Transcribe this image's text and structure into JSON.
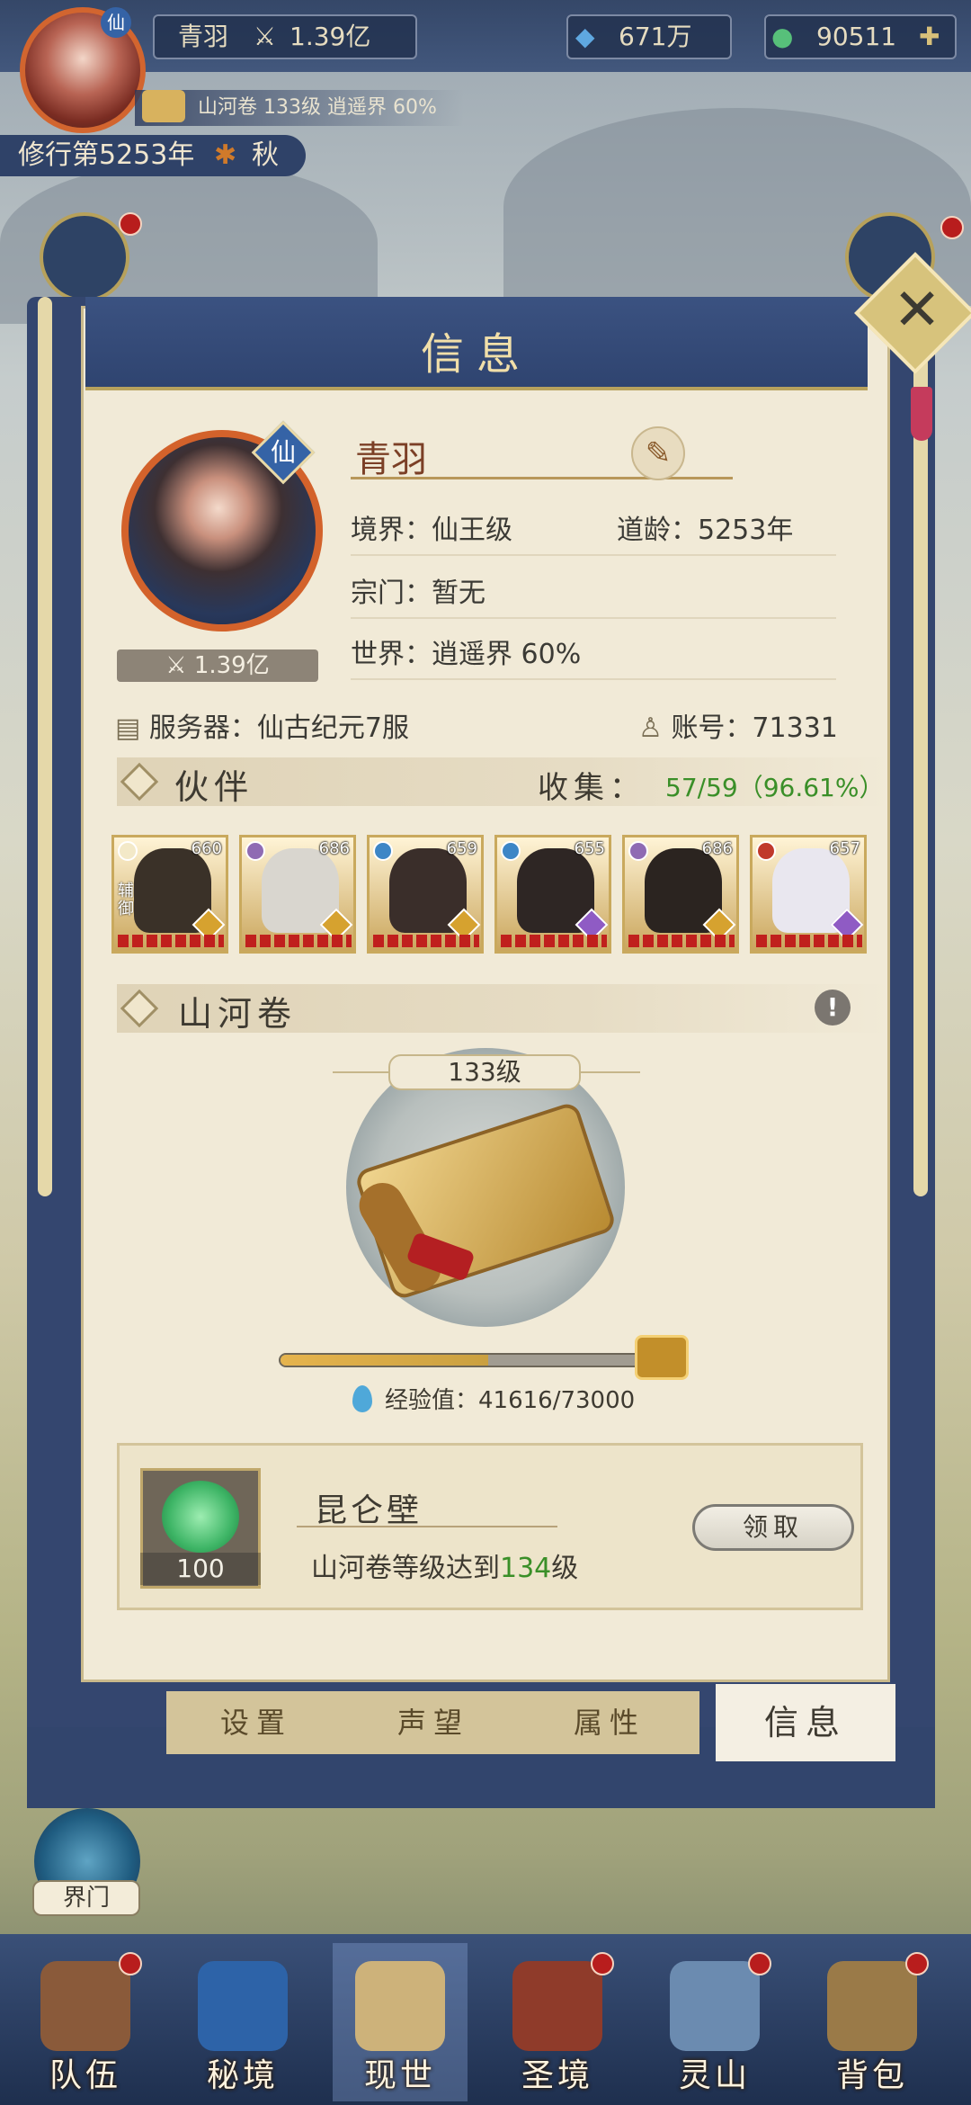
{
  "top_bar": {
    "player_name": "青羽",
    "power": "1.39亿",
    "spirit_stones": "671万",
    "jade": "90511",
    "avatar_badge": "仙",
    "sub_status": "山河卷 133级 逍遥界 60%",
    "cultivation_year": "修行第5253年",
    "season": "秋"
  },
  "panel": {
    "title": "信息",
    "close_label": "✕",
    "profile": {
      "badge": "仙",
      "power": "1.39亿",
      "name": "青羽",
      "realm": "境界：仙王级",
      "dao_age": "道龄：5253年",
      "sect": "宗门：暂无",
      "world": "世界：逍遥界  60%",
      "server": "服务器：仙古纪元7服",
      "account": "账号：71331"
    },
    "companions": {
      "title": "伙伴",
      "collect_label": "收集：",
      "collect_value": "57/59（96.61%）",
      "cards": [
        {
          "level": "660",
          "role": "辅御",
          "element_color": "#f3e9c8",
          "grade_color": "#d6a22f",
          "face_color": "#3a3128"
        },
        {
          "level": "686",
          "role": "",
          "element_color": "#8f6bb3",
          "grade_color": "#d6a22f",
          "face_color": "#d9d6cf"
        },
        {
          "level": "659",
          "role": "",
          "element_color": "#3d86c6",
          "grade_color": "#d6a22f",
          "face_color": "#3a2e2a"
        },
        {
          "level": "655",
          "role": "",
          "element_color": "#3d86c6",
          "grade_color": "#8f5bc4",
          "face_color": "#2e2624"
        },
        {
          "level": "686",
          "role": "",
          "element_color": "#8f6bb3",
          "grade_color": "#d6a22f",
          "face_color": "#2b2420"
        },
        {
          "level": "657",
          "role": "",
          "element_color": "#c0392b",
          "grade_color": "#8f5bc4",
          "face_color": "#e9e7ef"
        }
      ]
    },
    "scroll": {
      "title": "山河卷",
      "alert": "!",
      "level": "133级",
      "exp_text": "经验值：41616/73000",
      "progress": 0.57
    },
    "reward": {
      "item_qty": "100",
      "item_name": "昆仑壁",
      "desc_prefix": "山河卷等级达到",
      "desc_level": "134",
      "desc_suffix": "级",
      "claim_label": "领取"
    },
    "tabs": [
      {
        "label": "设置",
        "active": false
      },
      {
        "label": "声望",
        "active": false
      },
      {
        "label": "属性",
        "active": false
      },
      {
        "label": "信息",
        "active": true
      }
    ]
  },
  "side": {
    "gate_label": "界门"
  },
  "bottom_nav": [
    {
      "label": "队伍",
      "color": "#8a5a3a",
      "dot": true,
      "active": false
    },
    {
      "label": "秘境",
      "color": "#2d63a8",
      "dot": false,
      "active": false
    },
    {
      "label": "现世",
      "color": "#cdb27a",
      "dot": false,
      "active": true
    },
    {
      "label": "圣境",
      "color": "#8f3b2a",
      "dot": true,
      "active": false
    },
    {
      "label": "灵山",
      "color": "#6b8bb0",
      "dot": true,
      "active": false
    },
    {
      "label": "背包",
      "color": "#9a7a48",
      "dot": true,
      "active": false
    }
  ],
  "colors": {
    "panel_bg": "#f1ead7",
    "frame_blue": "#34466f",
    "accent_gold": "#c9a95d",
    "highlight_green": "#3a8f28"
  }
}
